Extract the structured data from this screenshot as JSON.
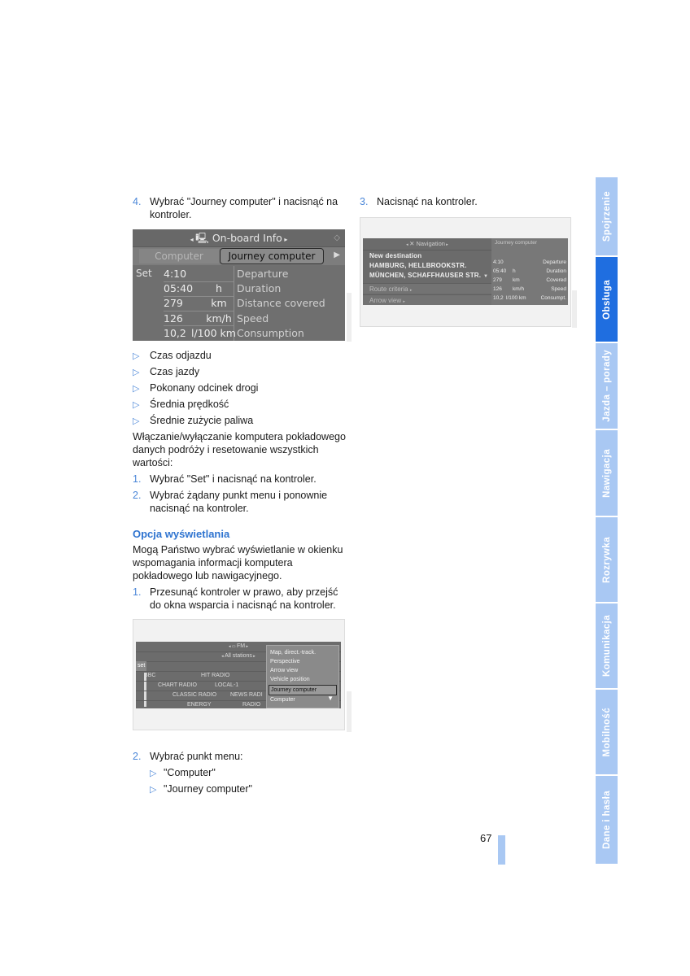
{
  "left_column": {
    "step4": {
      "num": "4.",
      "text": "Wybrać \"Journey computer\" i nacisnąć na kontroler."
    },
    "screen1": {
      "title": "On-board Info",
      "tabs": [
        "Computer",
        "Journey computer"
      ],
      "set_label": "Set",
      "rows": [
        {
          "value": "4:10",
          "unit": "",
          "label": "Departure"
        },
        {
          "value": "05:40",
          "unit": "h",
          "label": "Duration"
        },
        {
          "value": "279",
          "unit": "km",
          "label": "Distance covered"
        },
        {
          "value": "126",
          "unit": "km/h",
          "label": "Speed"
        },
        {
          "value": "10,2",
          "unit": "l/100 km",
          "label": "Consumption"
        }
      ]
    },
    "bullets": [
      "Czas odjazdu",
      "Czas jazdy",
      "Pokonany odcinek drogi",
      "Średnia prędkość",
      "Średnie zużycie paliwa"
    ],
    "para1": "Włączanie/wyłączanie komputera pokładowego danych podróży i resetowanie wszystkich wartości:",
    "steps_a": [
      {
        "num": "1.",
        "text": "Wybrać \"Set\" i nacisnąć na kontroler."
      },
      {
        "num": "2.",
        "text": "Wybrać żądany punkt menu i ponownie nacisnąć na kontroler."
      }
    ],
    "heading": "Opcja wyświetlania",
    "para2": "Mogą Państwo wybrać wyświetlanie w okienku wspomagania informacji komputera pokładowego lub nawigacyjnego.",
    "step_b1": {
      "num": "1.",
      "text": "Przesunąć kontroler w prawo, aby przejść do okna wsparcia i nacisnąć na kontroler."
    },
    "screen3": {
      "title": "FM",
      "subtitle": "All stations",
      "set_label": "set",
      "stations": [
        [
          "BBC",
          "HIT RADIO"
        ],
        [
          "CHART RADIO",
          "LOCAL-1"
        ],
        [
          "CLASSIC RADIO",
          "NEWS RADI"
        ],
        [
          "ENERGY",
          "RADIO"
        ]
      ],
      "popup_items": [
        "Map, direct.-track.",
        "Perspective",
        "Arrow view",
        "Vehicle position",
        "Journey computer",
        "Computer"
      ],
      "popup_selected": "Journey computer"
    },
    "step_b2": {
      "num": "2.",
      "text": "Wybrać punkt menu:"
    },
    "sub_bullets": [
      "\"Computer\"",
      "\"Journey computer\""
    ]
  },
  "right_column": {
    "step3": {
      "num": "3.",
      "text": "Nacisnąć na kontroler."
    },
    "screen2": {
      "title": "Navigation",
      "lines": [
        "New destination",
        "HAMBURG, HELLBROOKSTR.",
        "MÜNCHEN, SCHAFFHAUSER STR."
      ],
      "menus": [
        "Route criteria",
        "Arrow view"
      ],
      "panel_title": "Journey computer",
      "rows": [
        {
          "value": "4:10",
          "unit": "",
          "label": "Departure"
        },
        {
          "value": "05:40",
          "unit": "h",
          "label": "Duration"
        },
        {
          "value": "279",
          "unit": "km",
          "label": "Covered"
        },
        {
          "value": "126",
          "unit": "km/h",
          "label": "Speed"
        },
        {
          "value": "10,2",
          "unit": "l/100 km",
          "label": "Consumpt."
        }
      ]
    }
  },
  "side_tabs": [
    {
      "label": "Spojrzenie",
      "active": false
    },
    {
      "label": "Obsługa",
      "active": true
    },
    {
      "label": "Jazda – porady",
      "active": false
    },
    {
      "label": "Nawigacja",
      "active": false
    },
    {
      "label": "Rozrywka",
      "active": false
    },
    {
      "label": "Komunikacja",
      "active": false
    },
    {
      "label": "Mobilność",
      "active": false
    },
    {
      "label": "Dane i hasła",
      "active": false
    }
  ],
  "page_number": "67",
  "colors": {
    "accent": "#2f74d0",
    "tab_active": "#1f6ee0",
    "tab_inactive": "#a9c8f3"
  }
}
